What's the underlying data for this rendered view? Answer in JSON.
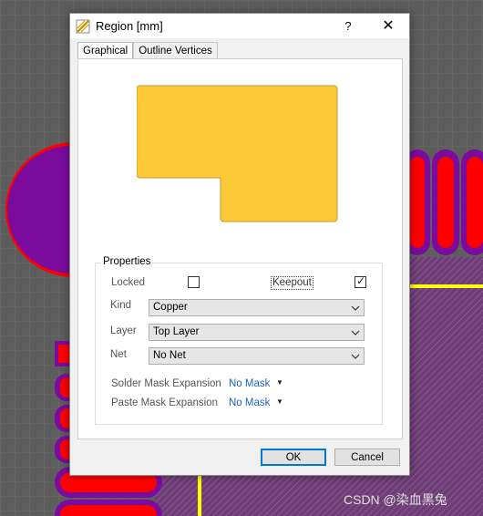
{
  "dialog": {
    "title": "Region [mm]",
    "help_label": "?",
    "close_label": "✕",
    "tabs": [
      {
        "label": "Graphical",
        "active": true
      },
      {
        "label": "Outline Vertices",
        "active": false
      }
    ],
    "preview_fill": "#fec937",
    "properties": {
      "legend": "Properties",
      "locked_label": "Locked",
      "locked": false,
      "keepout_label": "Keepout",
      "keepout": true,
      "kind_label": "Kind",
      "kind_value": "Copper",
      "layer_label": "Layer",
      "layer_value": "Top Layer",
      "net_label": "Net",
      "net_value": "No Net",
      "solder_label": "Solder Mask Expansion",
      "solder_value": "No Mask",
      "paste_label": "Paste Mask Expansion",
      "paste_value": "No Mask"
    },
    "buttons": {
      "ok": "OK",
      "cancel": "Cancel"
    }
  },
  "colors": {
    "pcb_bg": "#5d5d5d",
    "pad_red": "#ff0000",
    "pad_purple": "#7a0b9d",
    "track_yellow": "#ffff00",
    "accent": "#0078d7"
  },
  "watermark": "CSDN @染血黑兔"
}
